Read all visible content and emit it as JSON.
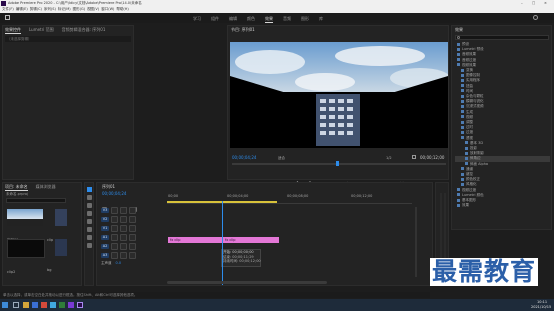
{
  "titlebar": {
    "title": "Adobe Premiere Pro 2020 - C:\\用户\\Idicy\\文档\\Adobe\\Premiere Pro\\14.0\\未命名"
  },
  "menubar": [
    "文件(F)",
    "编辑(E)",
    "剪辑(C)",
    "序列(S)",
    "标记(M)",
    "图形(G)",
    "视图(V)",
    "窗口(W)",
    "帮助(H)"
  ],
  "workspaces": [
    "学习",
    "组件",
    "编辑",
    "颜色",
    "效果",
    "音频",
    "图形",
    "库"
  ],
  "active_workspace": "效果",
  "source_panel": {
    "tabs": [
      "效果控件",
      "Lumetri 范围",
      "音频剪辑混合器: 序列01"
    ],
    "placeholder": "（未选择剪辑）"
  },
  "program_monitor": {
    "title": "节目: 序列01",
    "timecode_left": "00;00;04;24",
    "fit": "适合",
    "quality": "1/2",
    "timecode_right": "00;00;12;00"
  },
  "project_panel": {
    "tabs": [
      "项目: 未命名",
      "媒体浏览器"
    ],
    "name": "未命名.prproj",
    "items": [
      {
        "label": "序列01",
        "dur": "12;00"
      },
      {
        "label": "clip",
        "dur": "12;00"
      },
      {
        "label": "clip2",
        "dur": ""
      },
      {
        "label": "bg",
        "dur": ""
      }
    ]
  },
  "timeline": {
    "tab": "序列01",
    "timecode": "00;00;04;24",
    "ruler": [
      "00;00",
      "00;00;04;00",
      "00;00;08;00",
      "00;00;12;00"
    ],
    "tracks": [
      "V3",
      "V2",
      "V1",
      "A1",
      "A2",
      "A3"
    ],
    "master": "主声道",
    "master_val": "0.0",
    "clip_label": "fx clip",
    "clip_label2": "fx clip",
    "tooltip": {
      "title": "开始: 00;00;00;00",
      "l1": "结束: 00;00;11;29",
      "l2": "持续时间: 00;00;12;00"
    }
  },
  "effects_panel": {
    "title": "效果",
    "items": [
      "预设",
      "Lumetri 预设",
      "音频效果",
      "音频过渡",
      "视频效果",
      "变换",
      "图像控制",
      "实用程序",
      "扭曲",
      "时间",
      "杂色与颗粒",
      "模糊与锐化",
      "沉浸式视频",
      "生成",
      "视频",
      "调整",
      "过时",
      "过渡",
      "透视",
      "基本 3D",
      "投影",
      "放射阴影",
      "斜角边",
      "斜面 Alpha",
      "通道",
      "键控",
      "颜色校正",
      "风格化",
      "视频过渡",
      "Lumetri 颜色",
      "基本图形",
      "效果"
    ]
  },
  "statusbar": {
    "text": "单击以选择，或单击空白处并拖动以进行框选。按住Shift、Alt和Ctrl可选择其他选项。"
  },
  "taskbar": {
    "time": "10:11",
    "date": "2021/10/15"
  },
  "watermark": "最需教育",
  "colors": {
    "accent": "#2d8ceb",
    "clip": "#e377d6",
    "playhead": "#2d8ceb"
  }
}
